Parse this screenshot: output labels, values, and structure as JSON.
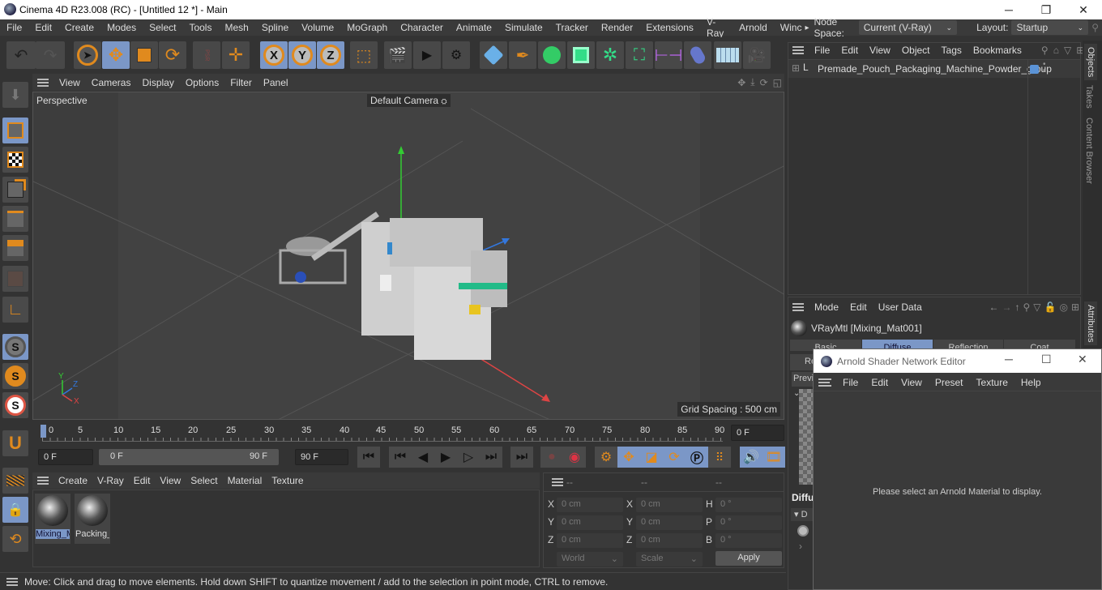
{
  "window": {
    "title": "Cinema 4D R23.008 (RC) - [Untitled 12 *] - Main",
    "minimize": "─",
    "maximize": "❐",
    "close": "✕"
  },
  "menubar": {
    "items": [
      "File",
      "Edit",
      "Create",
      "Modes",
      "Select",
      "Tools",
      "Mesh",
      "Spline",
      "Volume",
      "MoGraph",
      "Character",
      "Animate",
      "Simulate",
      "Tracker",
      "Render",
      "Extensions",
      "V-Ray",
      "Arnold",
      "Winc"
    ],
    "more_arrow": "▸",
    "node_space_label": "Node Space:",
    "node_space_value": "Current (V-Ray)",
    "layout_label": "Layout:",
    "layout_value": "Startup"
  },
  "toolbar": {
    "axis_x": "X",
    "axis_y": "Y",
    "axis_z": "Z",
    "psr": "PSR"
  },
  "viewport": {
    "menu": [
      "View",
      "Cameras",
      "Display",
      "Options",
      "Filter",
      "Panel"
    ],
    "projection": "Perspective",
    "camera": "Default Camera",
    "grid_spacing": "Grid Spacing : 500 cm",
    "axis_labels": {
      "x": "X",
      "y": "Y",
      "z": "Z"
    }
  },
  "timeline": {
    "ticks": [
      "0",
      "5",
      "10",
      "15",
      "20",
      "25",
      "30",
      "35",
      "40",
      "45",
      "50",
      "55",
      "60",
      "65",
      "70",
      "75",
      "80",
      "85",
      "90"
    ],
    "current_frame": "0 F",
    "start_frame": "0 F",
    "range_start": "0 F",
    "range_end": "90 F",
    "end_frame": "90 F"
  },
  "material_manager": {
    "menu": [
      "Create",
      "V-Ray",
      "Edit",
      "View",
      "Select",
      "Material",
      "Texture"
    ],
    "materials": [
      {
        "name": "Mixing_M",
        "selected": true
      },
      {
        "name": "Packing_",
        "selected": false
      }
    ]
  },
  "coordinates": {
    "headers": [
      "--",
      "--",
      "--"
    ],
    "rows": [
      {
        "l1": "X",
        "v1": "0 cm",
        "l2": "X",
        "v2": "0 cm",
        "l3": "H",
        "v3": "0 °"
      },
      {
        "l1": "Y",
        "v1": "0 cm",
        "l2": "Y",
        "v2": "0 cm",
        "l3": "P",
        "v3": "0 °"
      },
      {
        "l1": "Z",
        "v1": "0 cm",
        "l2": "Z",
        "v2": "0 cm",
        "l3": "B",
        "v3": "0 °"
      }
    ],
    "space": "World",
    "mode": "Scale",
    "apply": "Apply"
  },
  "status": "Move: Click and drag to move elements. Hold down SHIFT to quantize movement / add to the selection in point mode, CTRL to remove.",
  "objects": {
    "menu": [
      "File",
      "Edit",
      "View",
      "Object",
      "Tags",
      "Bookmarks"
    ],
    "items": [
      {
        "name": "Premade_Pouch_Packaging_Machine_Powder_group",
        "color": "#5b93d6"
      }
    ]
  },
  "side_tabs": [
    "Objects",
    "Takes",
    "Content Browser",
    "Attributes"
  ],
  "attributes": {
    "menu": [
      "Mode",
      "Edit",
      "User Data"
    ],
    "material_title": "VRayMtl [Mixing_Mat001]",
    "tabs": [
      "Basic",
      "Diffuse",
      "Reflection",
      "Coat"
    ],
    "active_tab": "Diffuse",
    "partial_tab": "Re",
    "preview_label": "Previ",
    "section": "Diffu",
    "subsection": "▾ D"
  },
  "arnold_editor": {
    "title": "Arnold Shader Network Editor",
    "menu": [
      "File",
      "Edit",
      "View",
      "Preset",
      "Texture",
      "Help"
    ],
    "message": "Please select an Arnold Material to display."
  }
}
